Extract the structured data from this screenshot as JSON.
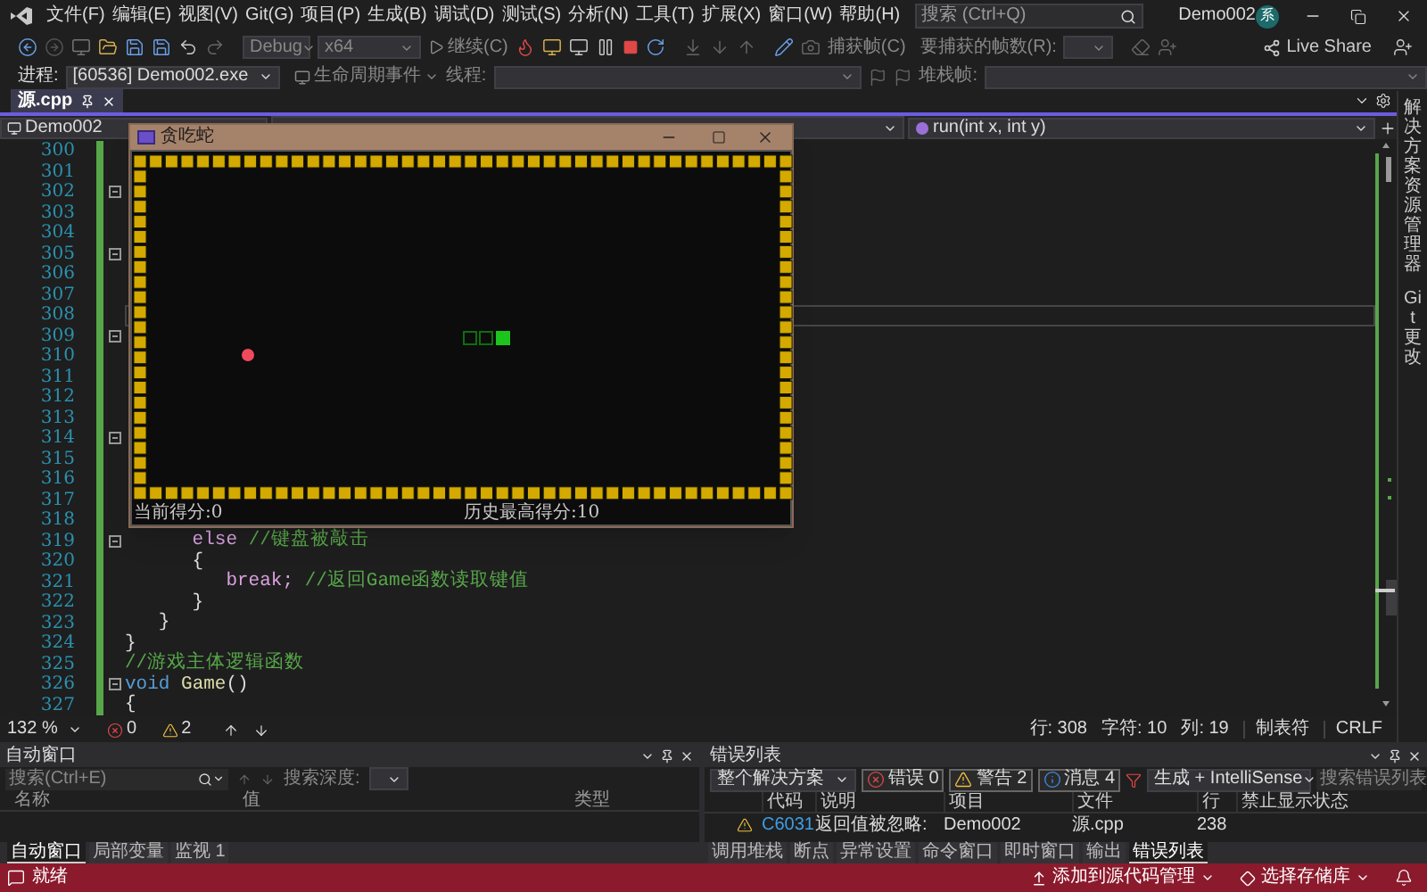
{
  "menu_bar": {
    "items": [
      "文件(F)",
      "编辑(E)",
      "视图(V)",
      "Git(G)",
      "项目(P)",
      "生成(B)",
      "调试(D)",
      "测试(S)",
      "分析(N)",
      "工具(T)",
      "扩展(X)",
      "窗口(W)",
      "帮助(H)"
    ],
    "search": {
      "placeholder": "搜索 (Ctrl+Q)"
    },
    "solution_name": "Demo002",
    "avatar_text": "系"
  },
  "toolbar": {
    "configuration": "Debug",
    "platform": "x64",
    "continue": "继续(C)",
    "capture_frame": "捕获帧(C)",
    "frames_label": "要捕获的帧数(R):",
    "live_share": "Live Share"
  },
  "debug_location": {
    "process_label": "进程:",
    "process": "[60536] Demo002.exe",
    "lifecycle_events": "生命周期事件",
    "thread_label": "线程:",
    "stack_frame_label": "堆栈帧:"
  },
  "editor": {
    "tabs": [
      {
        "label": "源.cpp",
        "selected": true
      }
    ],
    "nav": {
      "project": "Demo002",
      "member": "run(int x, int y)"
    },
    "lines": [
      {
        "number": "300",
        "fold": false,
        "changed": true,
        "current": false
      },
      {
        "number": "301",
        "fold": false,
        "changed": true,
        "current": false
      },
      {
        "number": "302",
        "fold": true,
        "changed": true,
        "current": false
      },
      {
        "number": "303",
        "fold": false,
        "changed": true,
        "current": false
      },
      {
        "number": "304",
        "fold": false,
        "changed": true,
        "current": false
      },
      {
        "number": "305",
        "fold": true,
        "changed": true,
        "current": false
      },
      {
        "number": "306",
        "fold": false,
        "changed": true,
        "current": false
      },
      {
        "number": "307",
        "fold": false,
        "changed": true,
        "current": false
      },
      {
        "number": "308",
        "fold": false,
        "changed": true,
        "current": true
      },
      {
        "number": "309",
        "fold": true,
        "changed": true,
        "current": false
      },
      {
        "number": "310",
        "fold": false,
        "changed": true,
        "current": false
      },
      {
        "number": "311",
        "fold": false,
        "changed": true,
        "current": false
      },
      {
        "number": "312",
        "fold": false,
        "changed": true,
        "current": false
      },
      {
        "number": "313",
        "fold": false,
        "changed": true,
        "current": false
      },
      {
        "number": "314",
        "fold": true,
        "changed": true,
        "current": false
      },
      {
        "number": "315",
        "fold": false,
        "changed": true,
        "current": false
      },
      {
        "number": "316",
        "fold": false,
        "changed": true,
        "current": false
      },
      {
        "number": "317",
        "fold": false,
        "changed": true,
        "current": false
      },
      {
        "number": "318",
        "fold": false,
        "changed": true,
        "current": false
      },
      {
        "number": "319",
        "fold": true,
        "changed": true,
        "current": false,
        "segments": [
          {
            "text": "      else",
            "kind": "control"
          },
          {
            "text": " //键盘被敲击",
            "kind": "comment"
          }
        ]
      },
      {
        "number": "320",
        "fold": false,
        "changed": true,
        "current": false,
        "segments": [
          {
            "text": "      {",
            "kind": "plain"
          }
        ]
      },
      {
        "number": "321",
        "fold": false,
        "changed": true,
        "current": false,
        "segments": [
          {
            "text": "         break;",
            "kind": "control"
          },
          {
            "text": " //返回Game函数读取键值",
            "kind": "comment"
          }
        ]
      },
      {
        "number": "322",
        "fold": false,
        "changed": true,
        "current": false,
        "segments": [
          {
            "text": "      }",
            "kind": "plain"
          }
        ]
      },
      {
        "number": "323",
        "fold": false,
        "changed": true,
        "current": false,
        "segments": [
          {
            "text": "   }",
            "kind": "plain"
          }
        ]
      },
      {
        "number": "324",
        "fold": false,
        "changed": true,
        "current": false,
        "segments": [
          {
            "text": "}",
            "kind": "plain"
          }
        ]
      },
      {
        "number": "325",
        "fold": false,
        "changed": true,
        "current": false,
        "segments": [
          {
            "text": "//游戏主体逻辑函数",
            "kind": "comment"
          }
        ]
      },
      {
        "number": "326",
        "fold": true,
        "changed": true,
        "current": false,
        "segments": [
          {
            "text": "void",
            "kind": "keyword"
          },
          {
            "text": " Game",
            "kind": "function"
          },
          {
            "text": "()",
            "kind": "plain"
          }
        ]
      },
      {
        "number": "327",
        "fold": false,
        "changed": true,
        "current": false,
        "segments": [
          {
            "text": "{",
            "kind": "plain"
          }
        ]
      }
    ],
    "status": {
      "zoom": "132 %",
      "errors": "0",
      "warnings": "2",
      "line": "行: 308",
      "char": "字符: 10",
      "col": "列: 19",
      "indent": "制表符",
      "eol": "CRLF"
    }
  },
  "game_window": {
    "title": "贪吃蛇",
    "score": "当前得分:0",
    "high_score": "历史最高得分:10"
  },
  "side_tabs": [
    "解决方案资源管理器",
    "Git 更改"
  ],
  "autos_panel": {
    "title": "自动窗口",
    "search": {
      "placeholder": "搜索(Ctrl+E)"
    },
    "depth_label": "搜索深度:",
    "columns": [
      "名称",
      "值",
      "类型"
    ],
    "tabs": [
      {
        "label": "自动窗口",
        "selected": true
      },
      {
        "label": "局部变量",
        "selected": false
      },
      {
        "label": "监视 1",
        "selected": false
      }
    ]
  },
  "error_list": {
    "title": "错误列表",
    "scope": "整个解决方案",
    "filters": [
      {
        "kind": "error",
        "label": "错误 0",
        "on": true
      },
      {
        "kind": "warning",
        "label": "警告 2",
        "on": true
      },
      {
        "kind": "info",
        "label": "消息 4",
        "on": true
      }
    ],
    "source": "生成 + IntelliSense",
    "search": {
      "placeholder": "搜索错误列表"
    },
    "columns": [
      "代码",
      "说明",
      "项目",
      "文件",
      "行",
      "禁止显示状态"
    ],
    "rows": [
      {
        "kind": "warning",
        "code": "C6031",
        "description": "返回值被忽略:",
        "project": "Demo002",
        "file": "源.cpp",
        "line": "238"
      }
    ],
    "tabs": [
      {
        "label": "调用堆栈",
        "selected": false
      },
      {
        "label": "断点",
        "selected": false
      },
      {
        "label": "异常设置",
        "selected": false
      },
      {
        "label": "命令窗口",
        "selected": false
      },
      {
        "label": "即时窗口",
        "selected": false
      },
      {
        "label": "输出",
        "selected": false
      },
      {
        "label": "错误列表",
        "selected": true
      }
    ]
  },
  "status_bar": {
    "message": "就绪",
    "source_control": "添加到源代码管理",
    "repository": "选择存储库"
  }
}
